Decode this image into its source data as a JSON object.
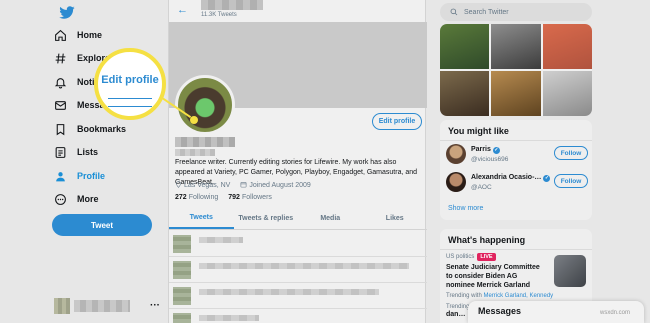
{
  "nav": {
    "items": [
      {
        "label": "Home",
        "icon": "home-icon"
      },
      {
        "label": "Explore",
        "icon": "hashtag-icon"
      },
      {
        "label": "Notifications",
        "icon": "bell-icon"
      },
      {
        "label": "Messages",
        "icon": "envelope-icon"
      },
      {
        "label": "Bookmarks",
        "icon": "bookmark-icon"
      },
      {
        "label": "Lists",
        "icon": "list-icon"
      },
      {
        "label": "Profile",
        "icon": "person-icon",
        "active": true
      },
      {
        "label": "More",
        "icon": "more-icon"
      }
    ],
    "tweet_label": "Tweet",
    "accent": "#1a8fd6"
  },
  "header": {
    "tweet_count": "11.3K Tweets"
  },
  "profile": {
    "edit_label": "Edit profile",
    "bio": "Freelance writer. Currently editing stories for Lifewire. My work has also appeared at Variety, PC Gamer, Polygon, Playboy, Engadget, Gamasutra, and GamesBeat.",
    "location": "Las Vegas, NV",
    "joined": "Joined August 2009",
    "following_count": "272",
    "following_label": "Following",
    "followers_count": "792",
    "followers_label": "Followers"
  },
  "tabs": [
    {
      "label": "Tweets",
      "active": true
    },
    {
      "label": "Tweets & replies"
    },
    {
      "label": "Media"
    },
    {
      "label": "Likes"
    }
  ],
  "callout": {
    "label": "Edit profile",
    "color": "#f5e043"
  },
  "search": {
    "placeholder": "Search Twitter"
  },
  "who_to_follow": {
    "title": "You might like",
    "accounts": [
      {
        "name": "Parris",
        "handle": "@vicious696",
        "button": "Follow"
      },
      {
        "name": "Alexandria Ocasio-…",
        "handle": "@AOC",
        "button": "Follow"
      }
    ],
    "show_more": "Show more"
  },
  "happening": {
    "title": "What's happening",
    "category": "US politics",
    "live_badge": "LIVE",
    "headline": "Senate Judiciary Committee to consider Biden AG nominee Merrick Garland",
    "trending_prefix": "Trending with",
    "trending_with": "Merrick Garland, Kennedy",
    "next_category": "Trending in …",
    "next_title": "dan…"
  },
  "messages_drawer": {
    "label": "Messages"
  },
  "watermark": "wsxdn.com"
}
